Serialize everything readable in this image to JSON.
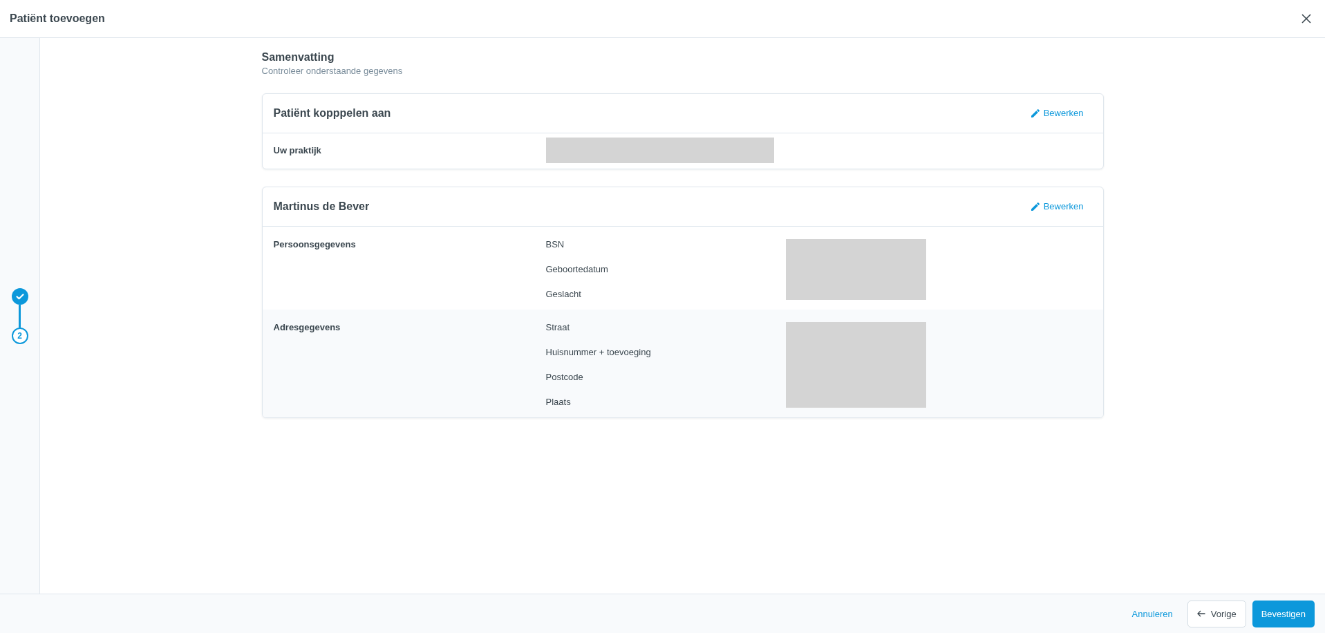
{
  "window": {
    "title": "Patiënt toevoegen"
  },
  "stepper": {
    "steps": [
      {
        "completed": true
      },
      {
        "completed": false,
        "number": "2"
      }
    ]
  },
  "summary": {
    "title": "Samenvatting",
    "subtitle": "Controleer onderstaande gegevens"
  },
  "cards": [
    {
      "title": "Patiënt kopppelen aan",
      "edit_label": "Bewerken",
      "sections": [
        {
          "label": "Uw praktijk",
          "redacted": true
        }
      ]
    },
    {
      "title": "Martinus de Bever",
      "edit_label": "Bewerken",
      "sections": [
        {
          "label": "Persoonsgegevens",
          "fields": [
            "BSN",
            "Geboortedatum",
            "Geslacht"
          ],
          "redacted": true
        },
        {
          "label": "Adresgegevens",
          "fields": [
            "Straat",
            "Huisnummer + toevoeging",
            "Postcode",
            "Plaats"
          ],
          "redacted": true
        }
      ]
    }
  ],
  "footer": {
    "buttons": [
      {
        "label": "Annuleren",
        "kind": "link"
      },
      {
        "label": "Vorige",
        "kind": "back"
      },
      {
        "label": "Bevestigen",
        "kind": "primary"
      }
    ]
  }
}
